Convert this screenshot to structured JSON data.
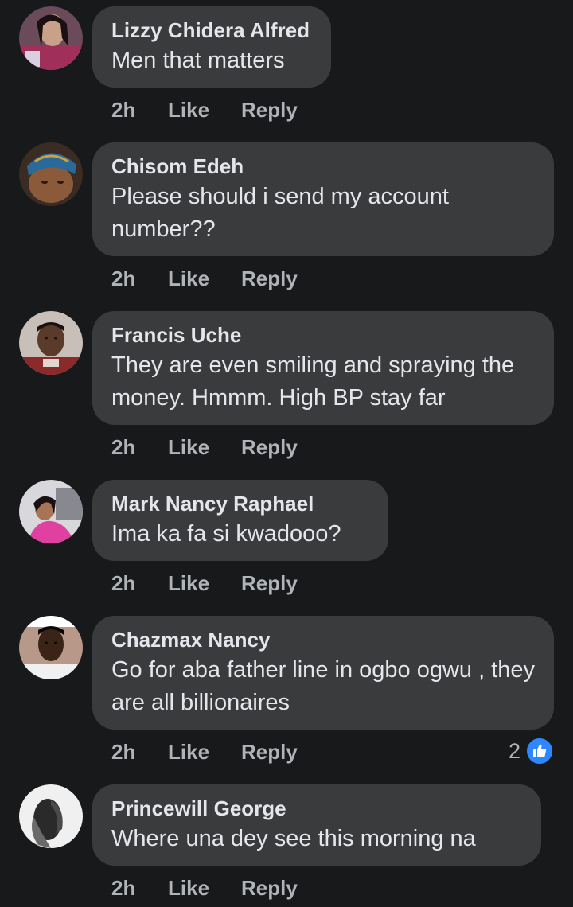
{
  "comments": [
    {
      "author": "Lizzy Chidera Alfred",
      "text": "Men that matters",
      "time": "2h",
      "like_label": "Like",
      "reply_label": "Reply",
      "avatar_icon": "profile-photo-woman"
    },
    {
      "author": "Chisom Edeh",
      "text": "Please should i send my account number??",
      "time": "2h",
      "like_label": "Like",
      "reply_label": "Reply",
      "avatar_icon": "profile-photo-headwrap"
    },
    {
      "author": "Francis Uche",
      "text": "They are even smiling and spraying the money. Hmmm. High BP stay far",
      "time": "2h",
      "like_label": "Like",
      "reply_label": "Reply",
      "avatar_icon": "profile-photo-man"
    },
    {
      "author": "Mark Nancy Raphael",
      "text": "Ima ka fa si kwadooo?",
      "time": "2h",
      "like_label": "Like",
      "reply_label": "Reply",
      "avatar_icon": "profile-photo-woman-pink"
    },
    {
      "author": "Chazmax Nancy",
      "text": "Go for aba father line in ogbo ogwu , they are all billionaires",
      "time": "2h",
      "like_label": "Like",
      "reply_label": "Reply",
      "reaction_count": "2",
      "reaction_icon": "like-thumb-icon",
      "avatar_icon": "profile-photo-man-2"
    },
    {
      "author": "Princewill George",
      "text": "Where una dey see this morning na",
      "time": "2h",
      "like_label": "Like",
      "reply_label": "Reply",
      "avatar_icon": "profile-photo-bw"
    }
  ],
  "colors": {
    "background": "#18191a",
    "bubble": "#3a3b3c",
    "primary_text": "#e4e6eb",
    "secondary_text": "#b0b3b8",
    "like_blue": "#2d88ff"
  }
}
